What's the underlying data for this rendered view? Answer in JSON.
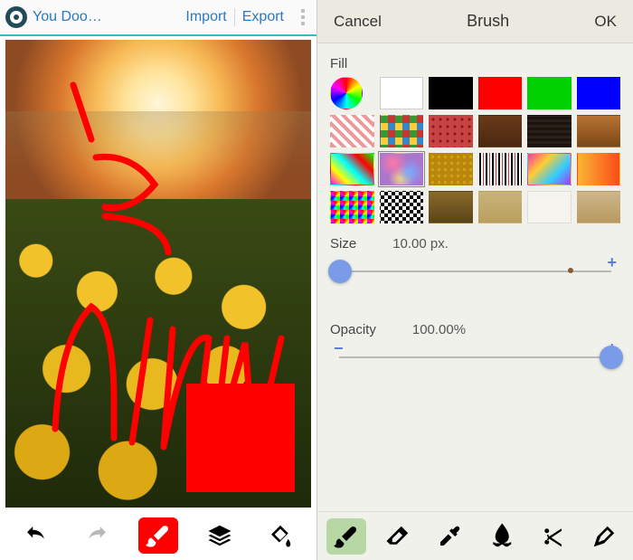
{
  "left": {
    "app_title": "You Doo…",
    "import_label": "Import",
    "export_label": "Export",
    "toolbar": {
      "undo": "undo",
      "redo": "redo",
      "brush": "brush",
      "layers": "layers",
      "bucket": "bucket"
    },
    "active_tool": "brush",
    "doodle_text": "Is DRAW",
    "brush_color": "#ff0000"
  },
  "right": {
    "cancel_label": "Cancel",
    "title": "Brush",
    "ok_label": "OK",
    "fill_label": "Fill",
    "swatches": [
      {
        "id": "color-wheel",
        "style": "wheel"
      },
      {
        "id": "white",
        "style": "background:#ffffff;border-color:#ccc"
      },
      {
        "id": "black",
        "style": "background:#000000"
      },
      {
        "id": "red",
        "style": "background:#ff0000"
      },
      {
        "id": "green",
        "style": "background:#00d000"
      },
      {
        "id": "blue",
        "style": "background:#0000ff"
      },
      {
        "id": "gingham",
        "style": "background:repeating-linear-gradient(45deg,#e99,#e99 4px,#fff 4px,#fff 8px),repeating-linear-gradient(-45deg,#e99,#e99 4px,#0000 4px,#0000 8px)"
      },
      {
        "id": "argyle",
        "style": "background:repeating-conic-gradient(#c33 0 25%,#38c 0 50%,#fc3 0 75%,#393 0 100%);background-size:16px 16px"
      },
      {
        "id": "red-dots",
        "style": "background:radial-gradient(#8a1a1a 30%,#c84444 31%);background-size:8px 8px"
      },
      {
        "id": "leather",
        "style": "background:linear-gradient(#6b3a1a,#4a2710)"
      },
      {
        "id": "dark-weave",
        "style": "background:repeating-linear-gradient(0deg,#1a1410,#1a1410 3px,#2a2018 3px,#2a2018 6px)"
      },
      {
        "id": "copper",
        "style": "background:linear-gradient(#b87333,#7a4716)"
      },
      {
        "id": "rainbow-noise",
        "style": "background:linear-gradient(45deg,#f0f,#ff0,#0ff,#f00,#0f0)"
      },
      {
        "id": "bokeh",
        "style": "background:radial-gradient(circle at 30% 30%,#f7a,#0000 40%),radial-gradient(circle at 70% 60%,#7af,#0000 40%),radial-gradient(circle at 50% 80%,#fd7,#0000 40%),#a7c",
        "selected": true
      },
      {
        "id": "gold-dots",
        "style": "background:radial-gradient(#d4a017 35%,#b8860b 36%);background-size:7px 7px"
      },
      {
        "id": "barcode",
        "style": "background:repeating-linear-gradient(90deg,#000,#000 2px,#fff 2px,#fff 4px,#c33 4px,#c33 5px,#fff 5px,#fff 7px)"
      },
      {
        "id": "diag-rainbow",
        "style": "background:linear-gradient(135deg,#f3a,#fc3,#3cf,#a3f)"
      },
      {
        "id": "warm-grad",
        "style": "background:linear-gradient(90deg,#f7b733,#fc4a1a)"
      },
      {
        "id": "pixel-rainbow",
        "style": "background:conic-gradient(#f00,#ff0,#0f0,#0ff,#00f,#f0f,#f00);background-size:10px 10px"
      },
      {
        "id": "checker",
        "style": "background:repeating-conic-gradient(#000 0 25%,#fff 0 50%);background-size:8px 8px"
      },
      {
        "id": "bronze",
        "style": "background:linear-gradient(#8a6a2a,#5a4418)"
      },
      {
        "id": "sand",
        "style": "background:linear-gradient(#c9b37a,#b89f5e)"
      },
      {
        "id": "offwhite",
        "style": "background:#f6f4ee;border-color:#ddd"
      },
      {
        "id": "tan",
        "style": "background:linear-gradient(#cdb68a,#b89a60)"
      }
    ],
    "size": {
      "label": "Size",
      "value_text": "10.00 px.",
      "value": 10,
      "min": 1,
      "max": 200,
      "thumb_pct": 2,
      "indicator_pct": 82
    },
    "opacity": {
      "label": "Opacity",
      "value_text": "100.00%",
      "value": 100,
      "min": 0,
      "max": 100,
      "thumb_pct": 97
    },
    "toolbar": {
      "items": [
        "brush",
        "eraser",
        "eyedropper",
        "smudge",
        "scissors",
        "pen"
      ],
      "active": "brush"
    }
  }
}
